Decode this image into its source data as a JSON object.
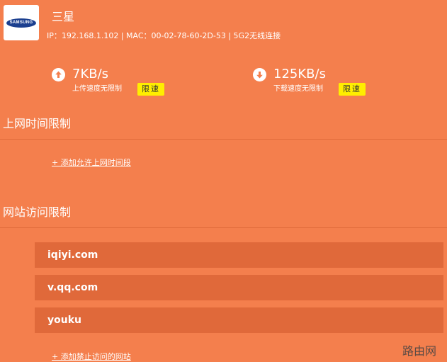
{
  "device": {
    "logo_text": "SAMSUNG",
    "name": "三星",
    "info": "IP：192.168.1.102 | MAC：00-02-78-60-2D-53 | 5G2无线连接"
  },
  "upload": {
    "icon": "arrow-up-circle-icon",
    "value": "7KB/s",
    "label": "上传速度无限制",
    "limit_label": "限速"
  },
  "download": {
    "icon": "arrow-down-circle-icon",
    "value": "125KB/s",
    "label": "下载速度无限制",
    "limit_label": "限速"
  },
  "time_limit": {
    "title": "上网时间限制",
    "add_label": "+ 添加允许上网时间段"
  },
  "site_limit": {
    "title": "网站访问限制",
    "sites": [
      "iqiyi.com",
      "v.qq.com",
      "youku"
    ],
    "add_label": "+ 添加禁止访问的网站"
  },
  "watermark": "路由网",
  "colors": {
    "background": "#f47f4d",
    "row": "#e0693a",
    "limit_button": "#ffee00"
  }
}
